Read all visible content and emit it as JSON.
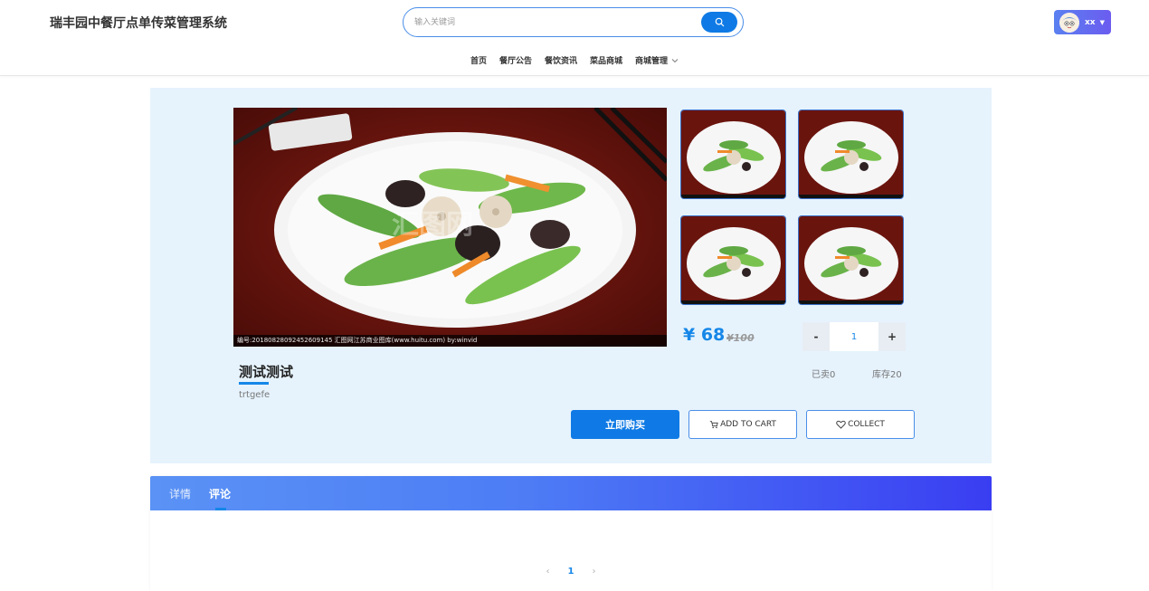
{
  "header": {
    "site_title": "瑞丰园中餐厅点单传菜管理系统",
    "search_placeholder": "输入关键词",
    "user_name": "xx"
  },
  "nav": {
    "items": [
      "首页",
      "餐厅公告",
      "餐饮资讯",
      "菜品商城",
      "商城管理"
    ]
  },
  "product": {
    "name": "测试测试",
    "description": "trtgefe",
    "price_current": "¥ 68",
    "price_original": "¥100",
    "quantity": "1",
    "qty_minus": "-",
    "qty_plus": "+",
    "sold": "已卖0",
    "stock": "库存20",
    "buy_label": "立即购买",
    "cart_label": "ADD TO CART",
    "collect_label": "COLLECT",
    "image_watermark": "编号:20180828092452609145 汇图网江苏商业图库(www.huitu.com) by:winvid",
    "image_logo": "汇图网"
  },
  "tabs": {
    "items": [
      "详情",
      "评论"
    ],
    "active": "评论"
  },
  "pagination": {
    "prev": "‹",
    "current": "1",
    "next": "›"
  },
  "colors": {
    "accent": "#0f7ae5",
    "panel_bg": "#e6f3fd",
    "tab_gradient_start": "#5a92f5",
    "tab_gradient_end": "#3a3ef2"
  }
}
